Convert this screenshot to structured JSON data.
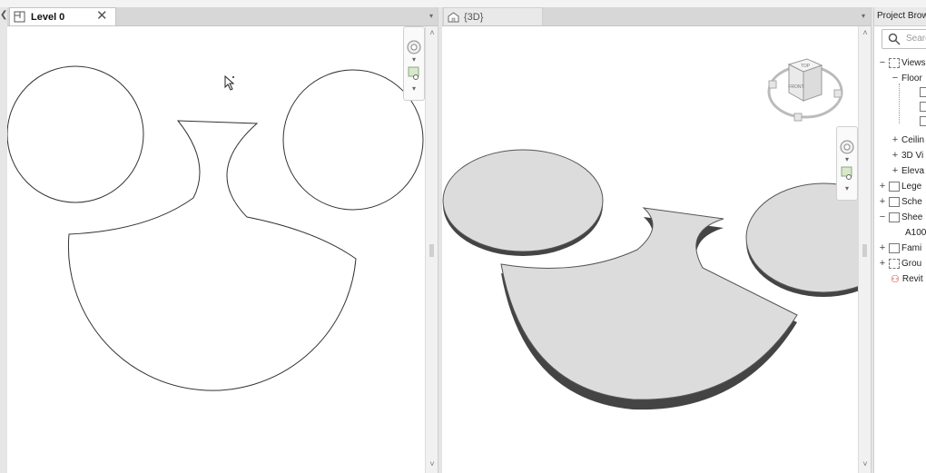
{
  "left_view": {
    "tab_label": "Level 0",
    "close_symbol": "✕",
    "dropdown_arrow": "▾"
  },
  "right_view": {
    "tab_label": "{3D}",
    "dropdown_arrow": "▾",
    "viewcube": {
      "top_face": "TOP",
      "front_face": "FRONT"
    }
  },
  "project_browser": {
    "title": "Project Brow",
    "search_placeholder": "Searc",
    "items": [
      {
        "toggle": "−",
        "label": "Views",
        "icon": "views-icon"
      },
      {
        "toggle": "−",
        "label": "Floor",
        "icon": "none"
      },
      {
        "toggle": "+",
        "label": "Ceilin",
        "icon": "none"
      },
      {
        "toggle": "+",
        "label": "3D Vi",
        "icon": "none"
      },
      {
        "toggle": "+",
        "label": "Eleva",
        "icon": "none"
      },
      {
        "toggle": "+",
        "label": "Lege",
        "icon": "legend-icon"
      },
      {
        "toggle": "+",
        "label": "Sche",
        "icon": "schedule-icon"
      },
      {
        "toggle": "−",
        "label": "Shee",
        "icon": "sheet-icon"
      },
      {
        "toggle": "",
        "label": "A100",
        "icon": "none"
      },
      {
        "toggle": "+",
        "label": "Fami",
        "icon": "family-icon"
      },
      {
        "toggle": "+",
        "label": "Grou",
        "icon": "group-icon"
      },
      {
        "toggle": "",
        "label": "Revit",
        "icon": "link-icon"
      }
    ]
  },
  "scroll": {
    "up": "˄",
    "down": "˅"
  }
}
